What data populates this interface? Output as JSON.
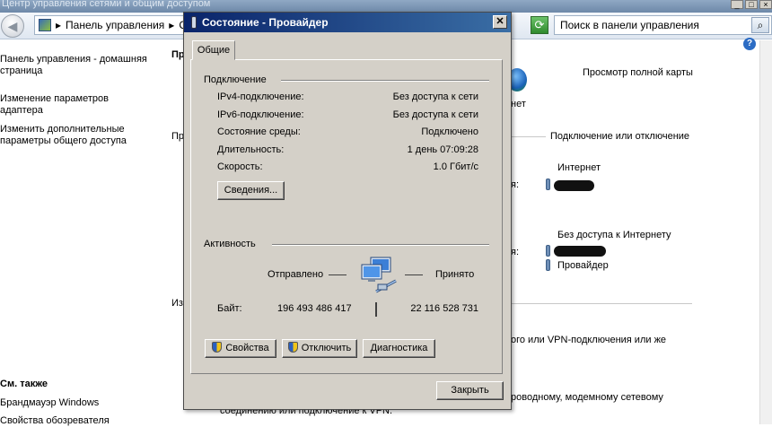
{
  "window": {
    "title": "Центр управления сетями и общим доступом",
    "address_root": "Панель управления",
    "address_next": "С",
    "search_placeholder": "Поиск в панели управления"
  },
  "sidebar": {
    "items": [
      {
        "label": "Панель управления - домашняя страница"
      },
      {
        "label": "Изменение параметров адаптера"
      },
      {
        "label": "Изменить дополнительные параметры общего доступа"
      }
    ],
    "see_also_title": "См. также",
    "see_also": [
      {
        "label": "Брандмауэр Windows"
      },
      {
        "label": "Свойства обозревателя"
      }
    ]
  },
  "background": {
    "frag_pr1": "Пр",
    "frag_pr2": "Пр",
    "frag_iz": "Из",
    "full_map_link": "Просмотр полной карты",
    "internet_under_globe": "нет",
    "connect_disconnect_link": "Подключение или отключение",
    "net1_type": "Интернет",
    "net1_suffix": "я:",
    "net2_type": "Без доступа к Интернету",
    "net2_suffix": "я:",
    "net2_adapter": "Провайдер",
    "setup_text1": "ого или VPN-подключения или же",
    "setup_text2": "роводному, модемному сетевому",
    "setup_text3": "соединению или подключение к VPN."
  },
  "dialog": {
    "title": "Состояние - Провайдер",
    "close_glyph": "✕",
    "tab_general": "Общие",
    "connection": {
      "group_label": "Подключение",
      "rows": [
        {
          "label": "IPv4-подключение:",
          "value": "Без доступа к сети"
        },
        {
          "label": "IPv6-подключение:",
          "value": "Без доступа к сети"
        },
        {
          "label": "Состояние среды:",
          "value": "Подключено"
        },
        {
          "label": "Длительность:",
          "value": "1 день 07:09:28"
        },
        {
          "label": "Скорость:",
          "value": "1.0 Гбит/с"
        }
      ],
      "details_button": "Сведения..."
    },
    "activity": {
      "group_label": "Активность",
      "sent_label": "Отправлено",
      "received_label": "Принято",
      "bytes_label": "Байт:",
      "bytes_sent": "196 493 486 417",
      "bytes_received": "22 116 528 731"
    },
    "buttons": {
      "properties": "Свойства",
      "disable": "Отключить",
      "diagnose": "Диагностика",
      "close": "Закрыть"
    }
  }
}
